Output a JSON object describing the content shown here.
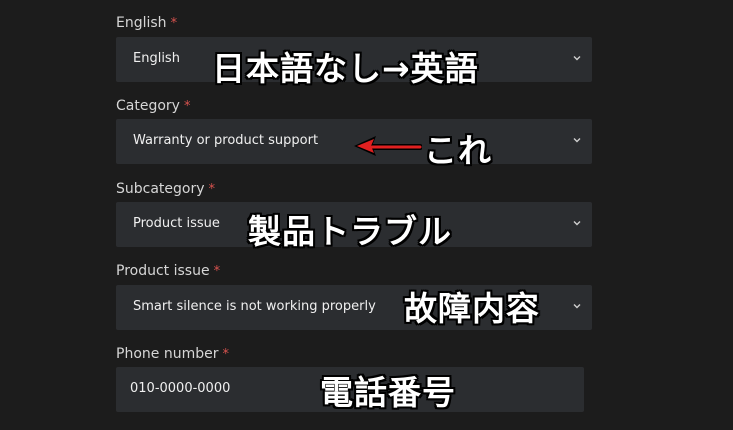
{
  "form": {
    "fields": [
      {
        "label": "English",
        "required_mark": "*",
        "value": "English",
        "type": "select"
      },
      {
        "label": "Category",
        "required_mark": "*",
        "value": "Warranty or product support",
        "type": "select"
      },
      {
        "label": "Subcategory",
        "required_mark": "*",
        "value": "Product issue",
        "type": "select"
      },
      {
        "label": "Product issue",
        "required_mark": "*",
        "value": "Smart silence is not working properly",
        "type": "select"
      },
      {
        "label": "Phone number",
        "required_mark": "*",
        "value": "010-0000-0000",
        "type": "text"
      }
    ]
  },
  "annotations": {
    "language": "日本語なし→英語",
    "category": "これ",
    "subcategory": "製品トラブル",
    "product_issue": "故障内容",
    "phone": "電話番号"
  },
  "icons": {
    "dropdown": "chevron-down-icon",
    "pointer": "red-arrow-left-icon"
  },
  "colors": {
    "background": "#1c1c1c",
    "field_bg": "#2b2d30",
    "required": "#d9534f",
    "arrow": "#e02020"
  }
}
